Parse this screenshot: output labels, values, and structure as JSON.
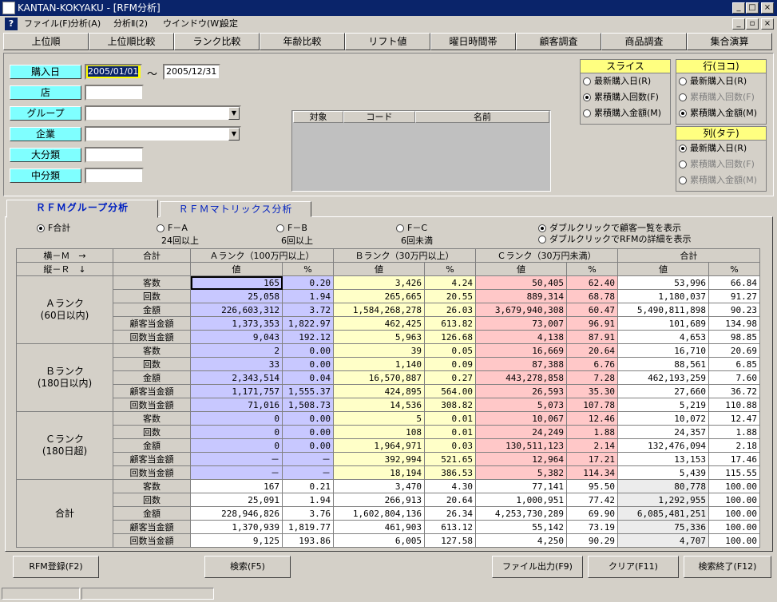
{
  "window": {
    "title": "KANTAN-KOKYAKU - [RFM分析]"
  },
  "menu": [
    "ファイル(F)",
    "分析(A)",
    "分析Ⅱ(2)",
    "ウインドウ(W)",
    "設定"
  ],
  "nav": [
    "上位順",
    "上位順比較",
    "ランク比較",
    "年齢比較",
    "リフト値",
    "曜日時間帯",
    "顧客調査",
    "商品調査",
    "集合演算"
  ],
  "filters": {
    "date_label": "購入日",
    "date_from": "2005/01/01",
    "tilde": "～",
    "date_to": "2005/12/31",
    "store_label": "店",
    "store_value": "",
    "group_label": "グループ",
    "company_label": "企業",
    "major_label": "大分類",
    "medium_label": "中分類",
    "list_headers": [
      "対象",
      "コード",
      "名前"
    ]
  },
  "slice": {
    "title": "スライス",
    "options": [
      "最新購入日(R)",
      "累積購入回数(F)",
      "累積購入金額(M)"
    ],
    "selected": 1
  },
  "row_axis": {
    "title": "行(ヨコ)",
    "options": [
      "最新購入日(R)",
      "累積購入回数(F)",
      "累積購入金額(M)"
    ],
    "selected": 2
  },
  "col_axis": {
    "title": "列(タテ)",
    "options": [
      "最新購入日(R)",
      "累積購入回数(F)",
      "累積購入金額(M)"
    ],
    "selected": 0
  },
  "tabs": [
    "ＲＦＭグループ分析",
    "ＲＦＭマトリックス分析"
  ],
  "freq": {
    "options": [
      {
        "label": "F合計",
        "sub": ""
      },
      {
        "label": "F－A",
        "sub": "24回以上"
      },
      {
        "label": "F－B",
        "sub": "6回以上"
      },
      {
        "label": "F－C",
        "sub": "6回未満"
      }
    ],
    "selected": 0
  },
  "dbl": {
    "options": [
      "ダブルクリックで顧客一覧を表示",
      "ダブルクリックでRFMの詳細を表示"
    ],
    "selected": 0
  },
  "grid": {
    "h_axis": "横－Ｍ　→",
    "v_axis": "縦－Ｒ　↓",
    "total_label": "合計",
    "col_groups": [
      "Ａランク（100万円以上）",
      "Ｂランク（30万円以上）",
      "Ｃランク（30万円未満）",
      "合計"
    ],
    "val_label": "値",
    "pct_label": "%",
    "metrics": [
      "客数",
      "回数",
      "金額",
      "顧客当金額",
      "回数当金額"
    ],
    "row_groups": [
      {
        "label": "Ａランク\n(60日以内)",
        "rows": [
          [
            "165",
            "0.20",
            "3,426",
            "4.24",
            "50,405",
            "62.40",
            "53,996",
            "66.84"
          ],
          [
            "25,058",
            "1.94",
            "265,665",
            "20.55",
            "889,314",
            "68.78",
            "1,180,037",
            "91.27"
          ],
          [
            "226,603,312",
            "3.72",
            "1,584,268,278",
            "26.03",
            "3,679,940,308",
            "60.47",
            "5,490,811,898",
            "90.23"
          ],
          [
            "1,373,353",
            "1,822.97",
            "462,425",
            "613.82",
            "73,007",
            "96.91",
            "101,689",
            "134.98"
          ],
          [
            "9,043",
            "192.12",
            "5,963",
            "126.68",
            "4,138",
            "87.91",
            "4,653",
            "98.85"
          ]
        ]
      },
      {
        "label": "Ｂランク\n(180日以内)",
        "rows": [
          [
            "2",
            "0.00",
            "39",
            "0.05",
            "16,669",
            "20.64",
            "16,710",
            "20.69"
          ],
          [
            "33",
            "0.00",
            "1,140",
            "0.09",
            "87,388",
            "6.76",
            "88,561",
            "6.85"
          ],
          [
            "2,343,514",
            "0.04",
            "16,570,887",
            "0.27",
            "443,278,858",
            "7.28",
            "462,193,259",
            "7.60"
          ],
          [
            "1,171,757",
            "1,555.37",
            "424,895",
            "564.00",
            "26,593",
            "35.30",
            "27,660",
            "36.72"
          ],
          [
            "71,016",
            "1,508.73",
            "14,536",
            "308.82",
            "5,073",
            "107.78",
            "5,219",
            "110.88"
          ]
        ]
      },
      {
        "label": "Ｃランク\n(180日超)",
        "rows": [
          [
            "0",
            "0.00",
            "5",
            "0.01",
            "10,067",
            "12.46",
            "10,072",
            "12.47"
          ],
          [
            "0",
            "0.00",
            "108",
            "0.01",
            "24,249",
            "1.88",
            "24,357",
            "1.88"
          ],
          [
            "0",
            "0.00",
            "1,964,971",
            "0.03",
            "130,511,123",
            "2.14",
            "132,476,094",
            "2.18"
          ],
          [
            "－",
            "－",
            "392,994",
            "521.65",
            "12,964",
            "17.21",
            "13,153",
            "17.46"
          ],
          [
            "－",
            "－",
            "18,194",
            "386.53",
            "5,382",
            "114.34",
            "5,439",
            "115.55"
          ]
        ]
      },
      {
        "label": "合計",
        "rows": [
          [
            "167",
            "0.21",
            "3,470",
            "4.30",
            "77,141",
            "95.50",
            "80,778",
            "100.00"
          ],
          [
            "25,091",
            "1.94",
            "266,913",
            "20.64",
            "1,000,951",
            "77.42",
            "1,292,955",
            "100.00"
          ],
          [
            "228,946,826",
            "3.76",
            "1,602,804,136",
            "26.34",
            "4,253,730,289",
            "69.90",
            "6,085,481,251",
            "100.00"
          ],
          [
            "1,370,939",
            "1,819.77",
            "461,903",
            "613.12",
            "55,142",
            "73.19",
            "75,336",
            "100.00"
          ],
          [
            "9,125",
            "193.86",
            "6,005",
            "127.58",
            "4,250",
            "90.29",
            "4,707",
            "100.00"
          ]
        ]
      }
    ]
  },
  "buttons": {
    "rfm": "RFM登録(F2)",
    "search": "検索(F5)",
    "export": "ファイル出力(F9)",
    "clear": "クリア(F11)",
    "exit": "検索終了(F12)"
  }
}
